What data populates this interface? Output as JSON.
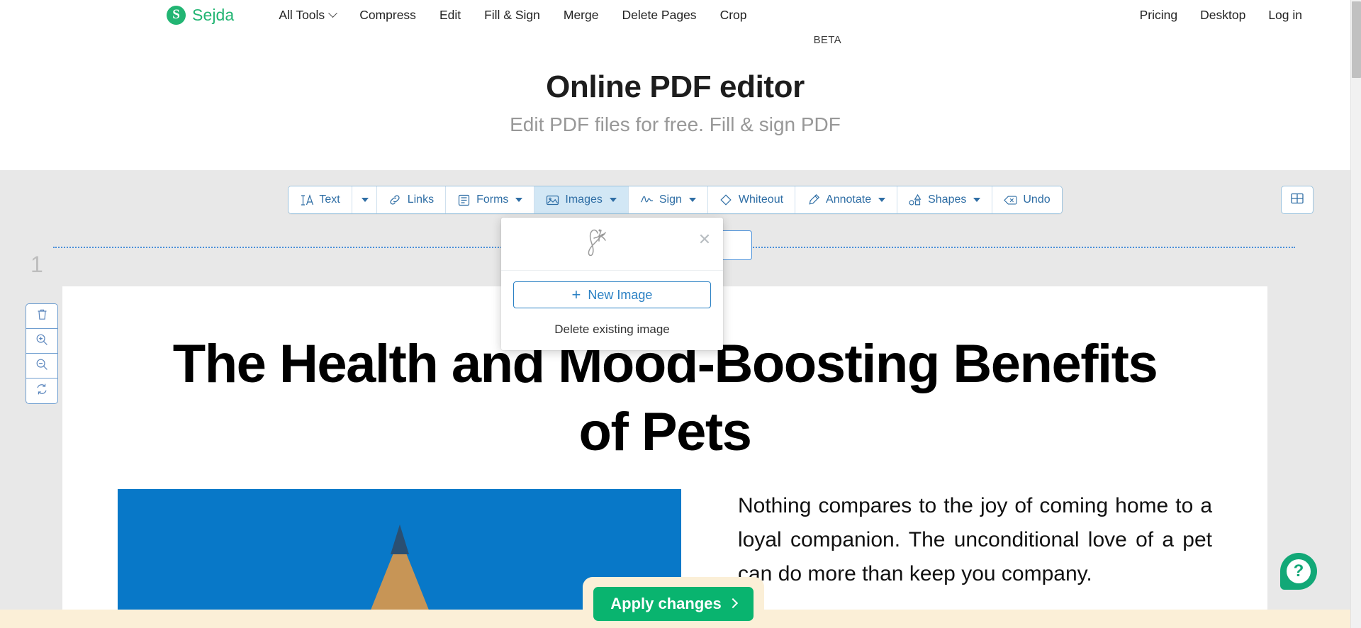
{
  "brand": {
    "mark": "S",
    "name": "Sejda"
  },
  "nav": {
    "left": [
      {
        "label": "All Tools",
        "has_caret": true
      },
      {
        "label": "Compress",
        "has_caret": false
      },
      {
        "label": "Edit",
        "has_caret": false
      },
      {
        "label": "Fill & Sign",
        "has_caret": false
      },
      {
        "label": "Merge",
        "has_caret": false
      },
      {
        "label": "Delete Pages",
        "has_caret": false
      },
      {
        "label": "Crop",
        "has_caret": false
      }
    ],
    "right": [
      {
        "label": "Pricing"
      },
      {
        "label": "Desktop"
      },
      {
        "label": "Log in"
      }
    ]
  },
  "hero": {
    "title": "Online PDF editor",
    "badge": "BETA",
    "subtitle": "Edit PDF files for free. Fill & sign PDF"
  },
  "toolbar": {
    "items": [
      {
        "label": "Text",
        "icon": "text-icon",
        "caret": false,
        "active": false
      },
      {
        "label": "",
        "icon": "",
        "caret": true,
        "active": false,
        "caret_only": true
      },
      {
        "label": "Links",
        "icon": "link-icon",
        "caret": false,
        "active": false
      },
      {
        "label": "Forms",
        "icon": "forms-icon",
        "caret": true,
        "active": false
      },
      {
        "label": "Images",
        "icon": "image-icon",
        "caret": true,
        "active": true
      },
      {
        "label": "Sign",
        "icon": "sign-icon",
        "caret": true,
        "active": false
      },
      {
        "label": "Whiteout",
        "icon": "whiteout-icon",
        "caret": false,
        "active": false
      },
      {
        "label": "Annotate",
        "icon": "annotate-icon",
        "caret": true,
        "active": false
      },
      {
        "label": "Shapes",
        "icon": "shapes-icon",
        "caret": true,
        "active": false
      },
      {
        "label": "Undo",
        "icon": "undo-icon",
        "caret": false,
        "active": false
      }
    ],
    "grid_view_icon": "grid-icon"
  },
  "images_dropdown": {
    "preview_alt": "signature-thumbnail",
    "close_icon": "close-icon",
    "new_image_label": "New Image",
    "new_image_plus": "+",
    "delete_existing_label": "Delete existing image"
  },
  "left_rail": {
    "page_number": "1",
    "buttons": [
      {
        "icon": "trash-icon",
        "name": "delete-page-button"
      },
      {
        "icon": "zoom-in-icon",
        "name": "zoom-in-button"
      },
      {
        "icon": "zoom-out-icon",
        "name": "zoom-out-button"
      },
      {
        "icon": "rotate-icon",
        "name": "rotate-page-button"
      }
    ]
  },
  "document": {
    "title": "The Health and Mood-Boosting Benefits of Pets",
    "photo_alt": "cat-photo",
    "paragraph": "Nothing compares to the joy of coming home to a loyal companion. The unconditional love of a pet can do more than keep you company."
  },
  "apply_bar": {
    "label": "Apply changes",
    "chevron": "chevron-right-icon"
  },
  "help": {
    "glyph": "?",
    "name": "help-button"
  },
  "colors": {
    "brand_green": "#22b573",
    "apply_green": "#09b46f",
    "toolbar_blue": "#2f6ea5",
    "active_tab_blue": "#d2e7f5",
    "photo_blue": "#0878c8",
    "editor_bg": "#e8e8e8",
    "apply_strip": "#fbefd7"
  }
}
